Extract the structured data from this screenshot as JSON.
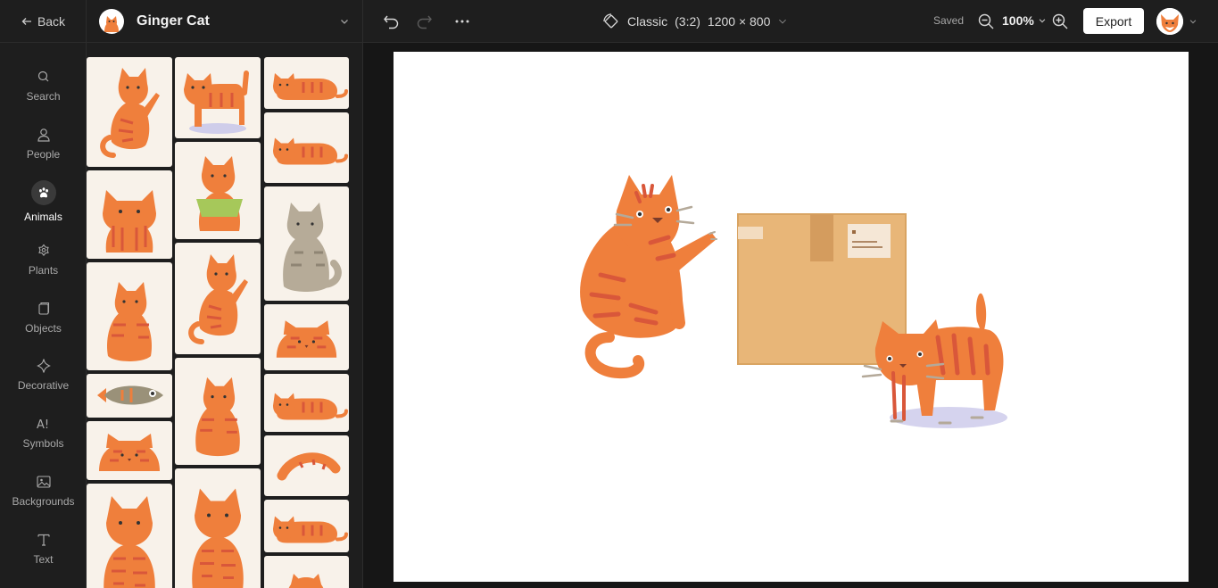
{
  "nav": {
    "back_label": "Back"
  },
  "rail": {
    "items": [
      {
        "label": "Search",
        "icon": "search-icon"
      },
      {
        "label": "People",
        "icon": "person-icon"
      },
      {
        "label": "Animals",
        "icon": "paw-icon",
        "active": true
      },
      {
        "label": "Plants",
        "icon": "flower-icon"
      },
      {
        "label": "Objects",
        "icon": "objects-icon"
      },
      {
        "label": "Decorative",
        "icon": "sparkle-icon"
      },
      {
        "label": "Symbols",
        "icon": "symbols-icon"
      },
      {
        "label": "Backgrounds",
        "icon": "image-icon"
      },
      {
        "label": "Text",
        "icon": "text-icon"
      }
    ]
  },
  "panel": {
    "title": "Ginger Cat"
  },
  "toolbar": {
    "format_name": "Classic",
    "format_ratio": "(3:2)",
    "format_size": "1200 × 800",
    "saved_label": "Saved",
    "zoom": "100%",
    "export_label": "Export"
  },
  "colors": {
    "accent_orange": "#ef7f3c",
    "stripe": "#d9573a",
    "box": "#e8b678",
    "tile_bg": "#f8f2ea"
  }
}
